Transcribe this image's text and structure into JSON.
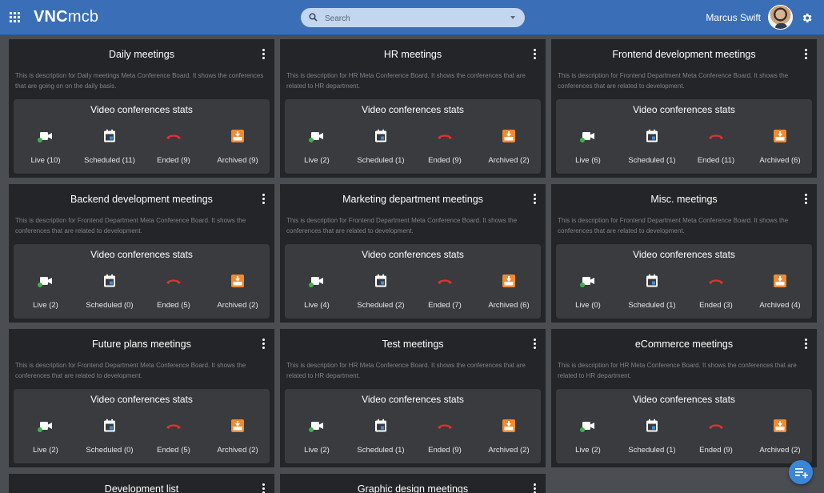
{
  "header": {
    "logo_bold": "VNC",
    "logo_rest": "mcb",
    "search_placeholder": "Search",
    "user_name": "Marcus Swift"
  },
  "stats_title": "Video conferences stats",
  "boards": [
    {
      "title": "Daily meetings",
      "description": "This is description for Daily meetings Meta Conference Board. It shows the conferences that are going on on the daily basis.",
      "live": "Live (10)",
      "scheduled": "Scheduled (11)",
      "ended": "Ended (9)",
      "archived": "Archived (9)"
    },
    {
      "title": "HR meetings",
      "description": "This is description for HR Meta Conference Board. It shows the conferences that are related to HR department.",
      "live": "Live (2)",
      "scheduled": "Scheduled (1)",
      "ended": "Ended (9)",
      "archived": "Archived (2)"
    },
    {
      "title": "Frontend development meetings",
      "description": "This is description for Frontend Department  Meta Conference Board. It shows the conferences that are related to development.",
      "live": "Live (6)",
      "scheduled": "Scheduled (1)",
      "ended": "Ended (11)",
      "archived": "Archived (6)"
    },
    {
      "title": "Backend development meetings",
      "description": "This is description for Frontend Department  Meta Conference Board. It shows the conferences that are related to development.",
      "live": "Live (2)",
      "scheduled": "Scheduled (0)",
      "ended": "Ended (5)",
      "archived": "Archived (2)"
    },
    {
      "title": "Marketing department meetings",
      "description": "This is description for Frontend Department  Meta Conference Board. It shows the conferences that are related to development.",
      "live": "Live (4)",
      "scheduled": "Scheduled (2)",
      "ended": "Ended (7)",
      "archived": "Archived (6)"
    },
    {
      "title": "Misc. meetings",
      "description": "This is description for Frontend Department  Meta Conference Board. It shows the conferences that are related to development.",
      "live": "Live (0)",
      "scheduled": "Scheduled (1)",
      "ended": "Ended (3)",
      "archived": "Archived (4)"
    },
    {
      "title": "Future plans meetings",
      "description": "This is description for Frontend Department  Meta Conference Board. It shows the conferences that are related to development.",
      "live": "Live (2)",
      "scheduled": "Scheduled (0)",
      "ended": "Ended (5)",
      "archived": "Archived (2)"
    },
    {
      "title": "Test meetings",
      "description": "This is description for HR Meta Conference Board. It shows the conferences that are related to HR department.",
      "live": "Live (2)",
      "scheduled": "Scheduled (1)",
      "ended": "Ended (9)",
      "archived": "Archived (2)"
    },
    {
      "title": "eCommerce meetings",
      "description": "This is description for HR Meta Conference Board. It shows the conferences that are related to HR department.",
      "live": "Live (2)",
      "scheduled": "Scheduled (1)",
      "ended": "Ended (9)",
      "archived": "Archived (2)"
    }
  ],
  "partial_boards": [
    {
      "title": "Development list"
    },
    {
      "title": "Graphic design meetings"
    }
  ],
  "icons": {
    "apps": "apps-grid-icon",
    "search": "search-icon",
    "settings": "gear-icon",
    "menu": "more-vert-icon",
    "live": "video-camera-icon",
    "scheduled": "calendar-icon",
    "ended": "call-end-icon",
    "archived": "archive-icon",
    "fab": "add-playlist-icon"
  },
  "colors": {
    "header_bg": "#3a6fb8",
    "card_bg": "#232528",
    "stats_bg": "#393b3f",
    "page_bg": "#4a4d52",
    "live_green": "#41b04a",
    "calendar_blue": "#3a8ee6",
    "ended_red": "#e0312f",
    "archive_orange": "#f28a2e",
    "fab_blue": "#3a86d8"
  }
}
